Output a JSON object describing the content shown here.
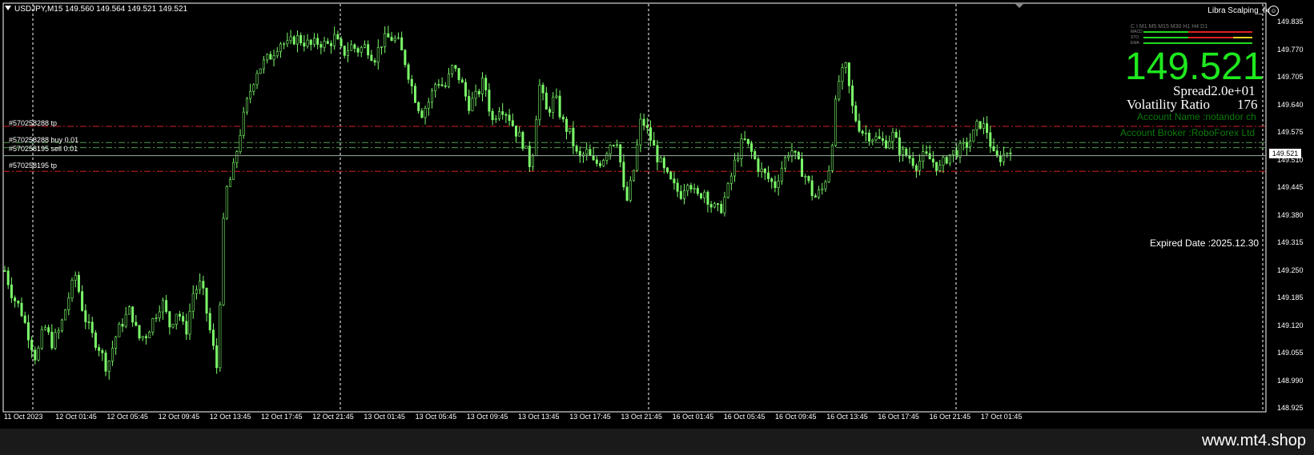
{
  "header": {
    "symbol_line": "USDJPY,M15  149.560 149.564 149.521 149.521",
    "ea_name": "Libra Scalping_fx",
    "smiley": "☺"
  },
  "info_panel": {
    "price": "149.521",
    "spread": "Spread2.0e+01",
    "volatility_label": "Volatility Ratio",
    "volatility_value": "176",
    "account_name": "Account Name :notandor ch",
    "account_broker": "Account Broker :RoboForex Ltd",
    "expired": "Expired Date :2025.12.30",
    "mtf_header": "C I  M1  M5  M15 M30  H1  H4  D1",
    "mtf_rows": [
      "MACD",
      "STO",
      "EMA"
    ]
  },
  "orders": [
    {
      "label": "#570258288 tp",
      "price": 149.59
    },
    {
      "label": "#570258288 buy 0.01",
      "price": 149.552
    },
    {
      "label": "#570258195 sell 0.01",
      "price": 149.54
    },
    {
      "label": "#570258195 tp",
      "price": 149.484
    }
  ],
  "current_price": "149.521",
  "watermark": "www.mt4.shop",
  "colors": {
    "candle": "#7cfc6a",
    "bid_line": "#9ab0a0",
    "tp_line": "#d02020",
    "entry_line": "#4f9a4f",
    "grid": "#ffffff"
  },
  "chart_data": {
    "type": "candlestick",
    "title": "USDJPY,M15",
    "y_ticks": [
      "149.835",
      "149.770",
      "149.705",
      "149.640",
      "149.575",
      "149.510",
      "149.445",
      "149.380",
      "149.315",
      "149.250",
      "149.185",
      "149.120",
      "149.055",
      "148.990",
      "148.925"
    ],
    "ylim": [
      148.925,
      149.835
    ],
    "x_ticks": [
      "11 Oct 2023",
      "12 Oct 01:45",
      "12 Oct 05:45",
      "12 Oct 09:45",
      "12 Oct 13:45",
      "12 Oct 17:45",
      "12 Oct 21:45",
      "13 Oct 01:45",
      "13 Oct 05:45",
      "13 Oct 09:45",
      "13 Oct 13:45",
      "13 Oct 17:45",
      "13 Oct 21:45",
      "16 Oct 01:45",
      "16 Oct 05:45",
      "16 Oct 09:45",
      "16 Oct 13:45",
      "16 Oct 17:45",
      "16 Oct 21:45",
      "17 Oct 01:45"
    ],
    "close_path": [
      149.25,
      149.19,
      149.16,
      149.1,
      149.04,
      149.12,
      149.08,
      149.11,
      149.18,
      149.24,
      149.15,
      149.1,
      149.07,
      149.02,
      149.09,
      149.13,
      149.16,
      149.09,
      149.1,
      149.14,
      149.18,
      149.12,
      149.16,
      149.1,
      149.2,
      149.22,
      149.12,
      149.02,
      149.43,
      149.48,
      149.58,
      149.66,
      149.72,
      149.74,
      149.76,
      149.79,
      149.78,
      149.8,
      149.79,
      149.78,
      149.79,
      149.78,
      149.8,
      149.76,
      149.78,
      149.77,
      149.78,
      149.75,
      149.79,
      149.8,
      149.79,
      149.74,
      149.67,
      149.62,
      149.65,
      149.7,
      149.68,
      149.73,
      149.7,
      149.64,
      149.66,
      149.7,
      149.6,
      149.64,
      149.62,
      149.58,
      149.55,
      149.49,
      149.69,
      149.62,
      149.66,
      149.6,
      149.57,
      149.51,
      149.53,
      149.5,
      149.51,
      149.55,
      149.56,
      149.4,
      149.48,
      149.61,
      149.57,
      149.52,
      149.48,
      149.45,
      149.43,
      149.47,
      149.42,
      149.44,
      149.4,
      149.39,
      149.44,
      149.51,
      149.56,
      149.53,
      149.49,
      149.47,
      149.45,
      149.5,
      149.54,
      149.5,
      149.47,
      149.42,
      149.44,
      149.5,
      149.69,
      149.73,
      149.62,
      149.58,
      149.57,
      149.56,
      149.55,
      149.57,
      149.53,
      149.52,
      149.5,
      149.52,
      149.51,
      149.49,
      149.52,
      149.53,
      149.54,
      149.56,
      149.6,
      149.58,
      149.51,
      149.52,
      149.54
    ],
    "legend": "none",
    "grid": "dashed vertical"
  }
}
